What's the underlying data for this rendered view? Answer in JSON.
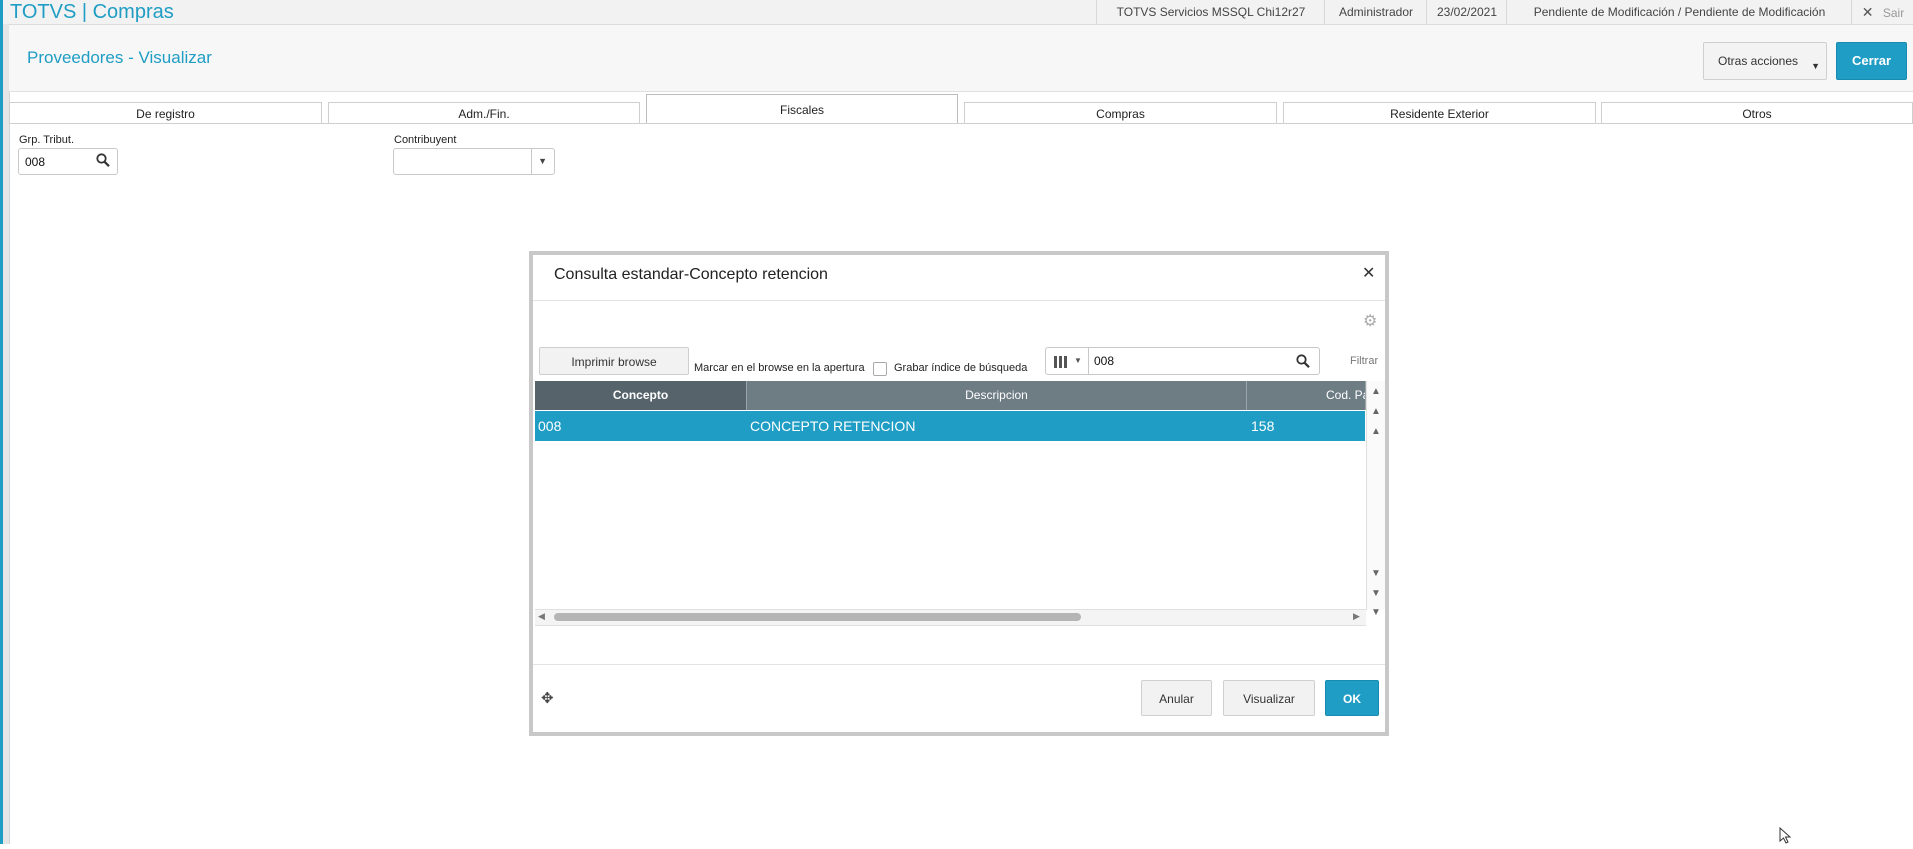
{
  "topbar": {
    "brand": "TOTVS | Compras",
    "server": "TOTVS Servicios MSSQL Chi12r27",
    "user": "Administrador",
    "date": "23/02/2021",
    "status": "Pendiente de Modificación / Pendiente de Modificación",
    "exit_label": "Sair"
  },
  "header": {
    "title": "Proveedores - Visualizar",
    "other_actions_label": "Otras acciones",
    "close_label": "Cerrar"
  },
  "tabs": [
    {
      "label": "De registro"
    },
    {
      "label": "Adm./Fin."
    },
    {
      "label": "Fiscales"
    },
    {
      "label": "Compras"
    },
    {
      "label": "Residente Exterior"
    },
    {
      "label": "Otros"
    }
  ],
  "active_tab": "Fiscales",
  "form": {
    "grp_tribut_label": "Grp. Tribut.",
    "grp_tribut_value": "008",
    "contribuyent_label": "Contribuyent",
    "contribuyent_value": ""
  },
  "modal": {
    "title": "Consulta estandar-Concepto retencion",
    "print_label": "Imprimir browse",
    "mark_label": "Marcar en el browse en la apertura",
    "save_index_label": "Grabar índice de búsqueda",
    "search_value": "008",
    "filter_label": "Filtrar",
    "columns": [
      "Concepto",
      "Descripcion",
      "Cod. Pai"
    ],
    "rows": [
      {
        "concepto": "008",
        "descripcion": "CONCEPTO RETENCION",
        "cod_pai": "158"
      }
    ],
    "cancel_label": "Anular",
    "view_label": "Visualizar",
    "ok_label": "OK"
  },
  "colors": {
    "accent": "#1f9dc4",
    "grid_header": "#6e7c84",
    "grid_header_first": "#56636a"
  }
}
